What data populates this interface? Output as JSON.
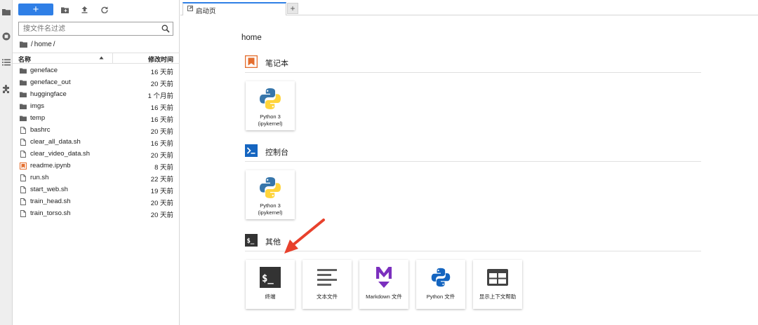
{
  "toolbar": {
    "new_label": "+",
    "icons": [
      "new-folder-icon",
      "upload-icon",
      "refresh-icon"
    ]
  },
  "filter": {
    "placeholder": "搜文件名过滤",
    "value": ""
  },
  "breadcrumb": {
    "root_icon": "folder-icon",
    "path": [
      "home"
    ],
    "separator": "/"
  },
  "file_list": {
    "columns": {
      "name": "名称",
      "modified": "修改时间"
    },
    "sort": "name-ascending",
    "rows": [
      {
        "name": "geneface",
        "modified": "16 天前",
        "type": "folder"
      },
      {
        "name": "geneface_out",
        "modified": "20 天前",
        "type": "folder"
      },
      {
        "name": "huggingface",
        "modified": "1 个月前",
        "type": "folder"
      },
      {
        "name": "imgs",
        "modified": "16 天前",
        "type": "folder"
      },
      {
        "name": "temp",
        "modified": "16 天前",
        "type": "folder"
      },
      {
        "name": "bashrc",
        "modified": "20 天前",
        "type": "file"
      },
      {
        "name": "clear_all_data.sh",
        "modified": "16 天前",
        "type": "file"
      },
      {
        "name": "clear_video_data.sh",
        "modified": "20 天前",
        "type": "file"
      },
      {
        "name": "readme.ipynb",
        "modified": "8 天前",
        "type": "notebook"
      },
      {
        "name": "run.sh",
        "modified": "22 天前",
        "type": "file"
      },
      {
        "name": "start_web.sh",
        "modified": "19 天前",
        "type": "file"
      },
      {
        "name": "train_head.sh",
        "modified": "20 天前",
        "type": "file"
      },
      {
        "name": "train_torso.sh",
        "modified": "20 天前",
        "type": "file"
      }
    ]
  },
  "tabs": [
    {
      "label": "启动页",
      "icon": "launcher-icon",
      "active": true
    }
  ],
  "tab_add_label": "+",
  "launcher": {
    "home": "home",
    "sections": [
      {
        "title": "笔记本",
        "icon": "notebook-icon",
        "cards": [
          {
            "line1": "Python 3",
            "line2": "(ipykernel)",
            "icon": "python-logo-icon"
          }
        ]
      },
      {
        "title": "控制台",
        "icon": "console-icon",
        "cards": [
          {
            "line1": "Python 3",
            "line2": "(ipykernel)",
            "icon": "python-logo-icon"
          }
        ]
      },
      {
        "title": "其他",
        "icon": "terminal-section-icon",
        "cards": [
          {
            "label": "终端",
            "icon": "terminal-icon"
          },
          {
            "label": "文本文件",
            "icon": "text-file-icon"
          },
          {
            "label": "Markdown 文件",
            "icon": "markdown-icon"
          },
          {
            "label": "Python 文件",
            "icon": "python-file-icon"
          },
          {
            "label": "显示上下文帮助",
            "icon": "context-help-icon"
          }
        ]
      }
    ]
  },
  "colors": {
    "accent": "#2f7fe6",
    "notebook": "#e46e2e",
    "console": "#0d47a1",
    "terminal": "#333333",
    "markdown": "#7b2fbe",
    "annotation_arrow": "#e8412c"
  },
  "activity_bar": [
    "folder-icon",
    "running-icon",
    "toc-icon",
    "extension-icon"
  ]
}
